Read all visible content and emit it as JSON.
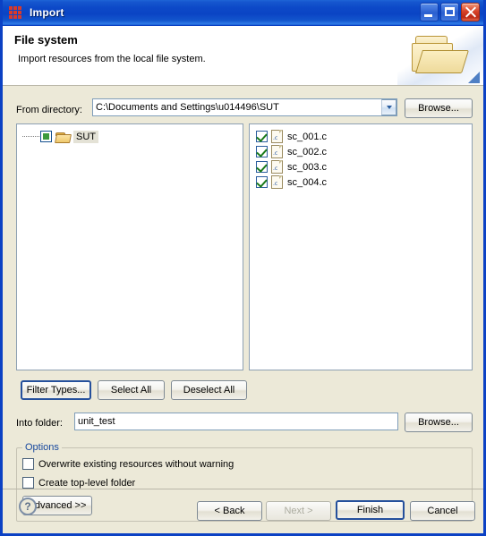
{
  "window": {
    "title": "Import",
    "icon": "grid-icon",
    "controls": {
      "minimize": "minimize-button",
      "maximize": "maximize-button",
      "close": "close-button"
    }
  },
  "banner": {
    "title": "File system",
    "description": "Import resources from the local file system.",
    "icon": "open-folder-icon"
  },
  "source": {
    "label": "From directory:",
    "value": "C:\\Documents and Settings\\u014496\\SUT",
    "placeholder": "",
    "browse_label": "Browse..."
  },
  "tree": {
    "items": [
      {
        "label": "SUT",
        "checkbox_state": "partial",
        "icon": "open-folder-icon",
        "selected": true
      }
    ]
  },
  "files": {
    "items": [
      {
        "label": "sc_001.c",
        "checked": true,
        "icon": "c-file-icon",
        "ext": ".c"
      },
      {
        "label": "sc_002.c",
        "checked": true,
        "icon": "c-file-icon",
        "ext": ".c"
      },
      {
        "label": "sc_003.c",
        "checked": true,
        "icon": "c-file-icon",
        "ext": ".c"
      },
      {
        "label": "sc_004.c",
        "checked": true,
        "icon": "c-file-icon",
        "ext": ".c"
      }
    ]
  },
  "filter_buttons": {
    "filter_types": "Filter Types...",
    "select_all": "Select All",
    "deselect_all": "Deselect All"
  },
  "destination": {
    "label": "Into folder:",
    "value": "unit_test",
    "placeholder": "",
    "browse_label": "Browse..."
  },
  "options": {
    "title": "Options",
    "checkboxes": [
      {
        "label": "Overwrite existing resources without warning",
        "checked": false
      },
      {
        "label": "Create top-level folder",
        "checked": false
      }
    ],
    "advanced_label": "Advanced >>"
  },
  "footer": {
    "help_label": "?",
    "back_label": "< Back",
    "next_label": "Next >",
    "next_disabled": true,
    "finish_label": "Finish",
    "cancel_label": "Cancel"
  },
  "colors": {
    "title_bar": "#0a44c4",
    "dialog_bg": "#ece9d8",
    "group_title": "#16479d",
    "check_green": "#1a7a1a",
    "close_red": "#d8432a"
  }
}
